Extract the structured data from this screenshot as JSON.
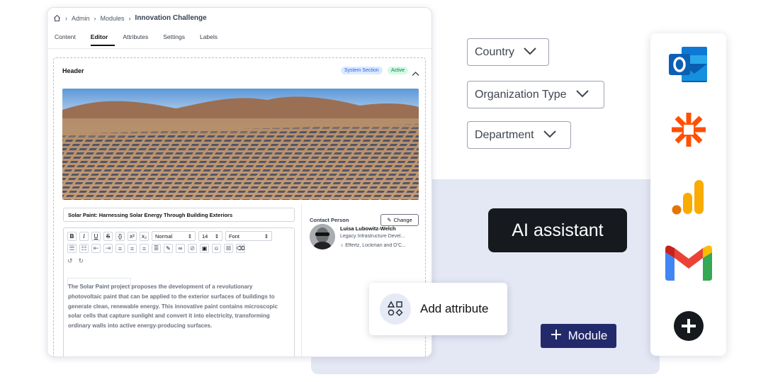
{
  "breadcrumb": {
    "items": [
      "Admin",
      "Modules"
    ],
    "current": "Innovation Challenge"
  },
  "tabs": [
    {
      "label": "Content",
      "active": false
    },
    {
      "label": "Editor",
      "active": true
    },
    {
      "label": "Attributes",
      "active": false
    },
    {
      "label": "Settings",
      "active": false
    },
    {
      "label": "Labels",
      "active": false
    }
  ],
  "section": {
    "title": "Header",
    "badge_system": "System Section",
    "badge_active": "Active"
  },
  "editor": {
    "title": "Solar Paint: Harnessing Solar Energy Through Building Exteriors",
    "paragraph_style": "Normal",
    "font_size": "14",
    "font": "Font",
    "body": "The Solar Paint project proposes the development of a revolutionary photovoltaic paint that can be applied to the exterior surfaces of buildings to generate clean, renewable energy. This innovative paint contains microscopic solar cells that capture sunlight and convert it into electricity, transforming ordinary walls into active energy-producing surfaces."
  },
  "contact": {
    "label": "Contact Person",
    "change_label": "Change",
    "name": "Luisa Lubowitz-Welch",
    "role": "Legacy Infrastructure Devel...",
    "org": "Effertz, Lockman and O'C..."
  },
  "filters": {
    "country": "Country",
    "organization_type": "Organization Type",
    "department": "Department"
  },
  "ai_assistant_label": "AI assistant",
  "add_attribute_label": "Add attribute",
  "module_button_label": "Module",
  "apps": [
    "outlook-icon",
    "zapier-icon",
    "google-analytics-icon",
    "gmail-icon",
    "add-integration-icon"
  ],
  "colors": {
    "module_button": "#232a6b",
    "ai_assistant_bg": "#16191d",
    "panel_bg": "#e4e7f4",
    "badge_system": "#dbeafe",
    "badge_active": "#d1fae5"
  }
}
